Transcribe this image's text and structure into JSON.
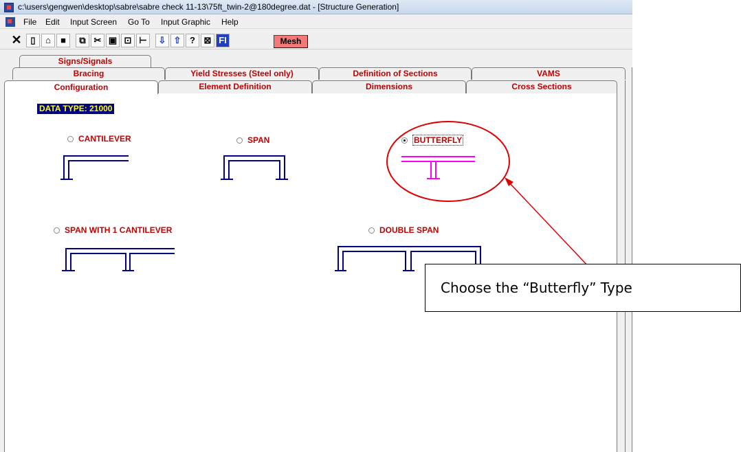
{
  "window": {
    "title": "c:\\users\\gengwen\\desktop\\sabre\\sabre check 11-13\\75ft_twin-2@180degree.dat - [Structure Generation]"
  },
  "menu": [
    "File",
    "Edit",
    "Input Screen",
    "Go To",
    "Input Graphic",
    "Help"
  ],
  "toolbar": {
    "icons": [
      "close-icon",
      "new-file-icon",
      "open-folder-icon",
      "save-icon",
      "copy-icon",
      "cut-icon",
      "paste-icon",
      "clipboard-icon",
      "tree-icon",
      "arrow-down-icon",
      "arrow-up-icon",
      "help-pointer-icon",
      "chart-icon",
      "fi-icon"
    ],
    "fi_label": "FI",
    "mesh_label": "Mesh"
  },
  "tabs": {
    "row1": [
      "Signs/Signals"
    ],
    "row2": [
      "Bracing",
      "Yield Stresses (Steel only)",
      "Definition of Sections",
      "VAMS"
    ],
    "row3": [
      "Configuration",
      "Element Definition",
      "Dimensions",
      "Cross Sections"
    ],
    "active": "Configuration"
  },
  "config": {
    "data_type": "DATA TYPE: 21000",
    "options": {
      "cantilever": "CANTILEVER",
      "span": "SPAN",
      "butterfly": "BUTTERFLY",
      "span_with_cantilever": "SPAN WITH 1 CANTILEVER",
      "double_span": "DOUBLE SPAN"
    },
    "selected": "BUTTERFLY"
  },
  "colors": {
    "structure": "#000080",
    "selected_structure": "#ff00ff",
    "label": "#c00000",
    "annotation": "#e00000"
  },
  "callout": {
    "text": "Choose the “Butterfly” Type"
  }
}
